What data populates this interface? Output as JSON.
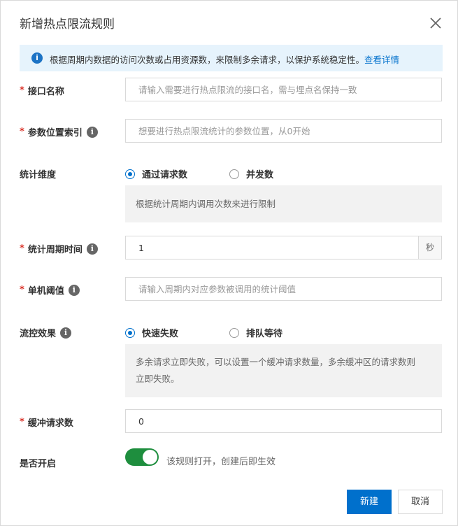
{
  "dialog": {
    "title": "新增热点限流规则",
    "close_icon": "close-icon"
  },
  "notice": {
    "icon": "info-icon",
    "text": "根据周期内数据的访问次数或占用资源数，来限制多余请求，以保护系统稳定性。",
    "link": "查看详情"
  },
  "fields": {
    "api_name": {
      "label": "接口名称",
      "required": "*",
      "placeholder": "请输入需要进行热点限流的接口名，需与埋点名保持一致"
    },
    "param_index": {
      "label": "参数位置索引",
      "required": "*",
      "placeholder": "想要进行热点限流统计的参数位置，从0开始"
    },
    "dimension": {
      "label": "统计维度",
      "options": [
        "通过请求数",
        "并发数"
      ],
      "selected": "通过请求数",
      "hint": "根据统计周期内调用次数来进行限制"
    },
    "period": {
      "label": "统计周期时间",
      "required": "*",
      "value": "1",
      "unit": "秒"
    },
    "threshold": {
      "label": "单机阈值",
      "required": "*",
      "placeholder": "请输入周期内对应参数被调用的统计阈值"
    },
    "effect": {
      "label": "流控效果",
      "options": [
        "快速失败",
        "排队等待"
      ],
      "selected": "快速失败",
      "hint_line1": "多余请求立即失败，可以设置一个缓冲请求数量，多余缓冲区的请求数则",
      "hint_line2": "立即失败。"
    },
    "buffer": {
      "label": "缓冲请求数",
      "required": "*",
      "value": "0"
    },
    "enabled": {
      "label": "是否开启",
      "on": true,
      "text": "该规则打开，创建后即生效"
    }
  },
  "buttons": {
    "create": "新建",
    "cancel": "取消"
  },
  "colors": {
    "primary": "#0070cc",
    "toggle_on": "#1e8e3e",
    "required": "#d93026",
    "notice_bg": "#e6f3fc"
  }
}
